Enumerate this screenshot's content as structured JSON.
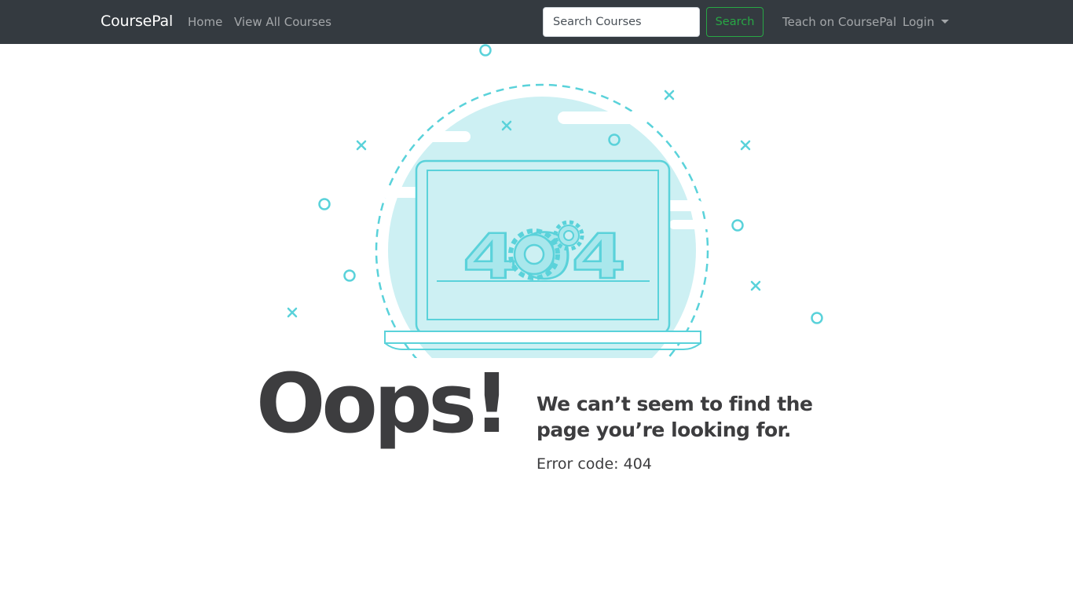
{
  "navbar": {
    "brand": "CoursePal",
    "links": [
      "Home",
      "View All Courses"
    ],
    "search": {
      "placeholder": "Search Courses",
      "value": "",
      "button_label": "Search"
    },
    "teach_label": "Teach on CoursePal",
    "login_label": "Login"
  },
  "illustration": {
    "text": "404"
  },
  "error": {
    "headline": "Oops!",
    "message_lines": [
      "We can’t seem to find the",
      "page you’re looking for."
    ],
    "code_text": "Error code: 404"
  },
  "colors": {
    "navbar": "#343a40",
    "accent": "#5ad2da",
    "accent_fill": "#cdf0f3",
    "text": "#3d3d3f",
    "search_button": "#28a745"
  }
}
